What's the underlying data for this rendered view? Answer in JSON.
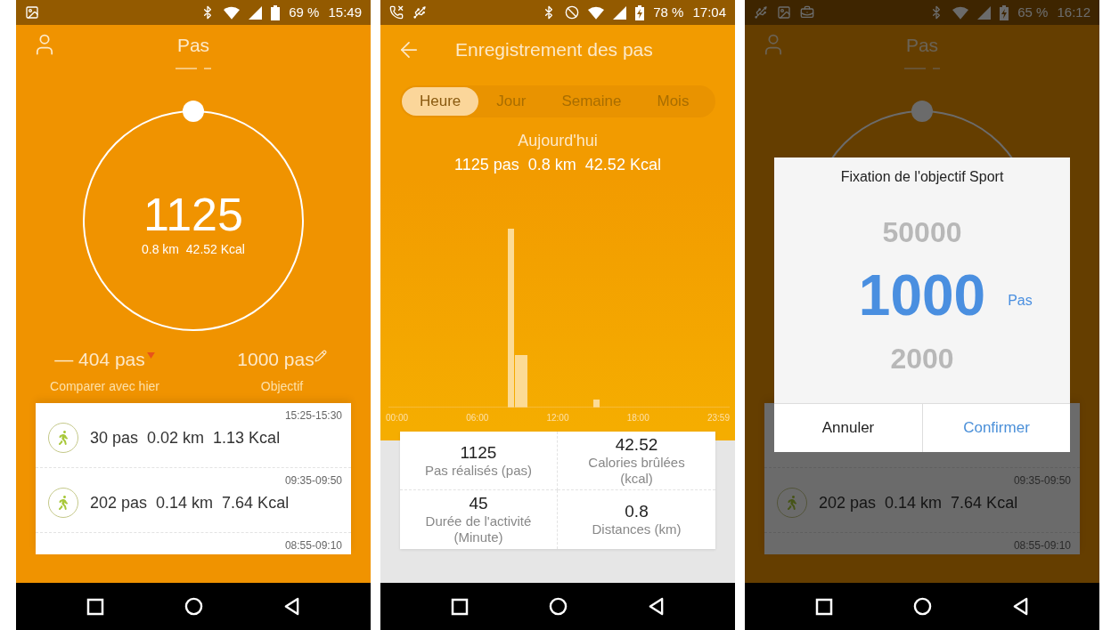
{
  "screens": [
    {
      "kind": "home",
      "status_bar": {
        "left_icons": [
          {
            "kind": "image"
          }
        ],
        "right_icons": [
          {
            "kind": "bluetooth"
          },
          {
            "kind": "wifi"
          },
          {
            "kind": "signal"
          },
          {
            "kind": "battery"
          }
        ],
        "charging": false,
        "battery": "69 %",
        "time": "15:49"
      },
      "title": "Pas",
      "ring": {
        "steps": "1125",
        "summary": "0.8 km  42.52 Kcal"
      },
      "compare": {
        "value": "— 404 pas",
        "label": "Comparer avec hier"
      },
      "goal": {
        "value": "1000 pas",
        "label": "Objectif"
      },
      "records": [
        {
          "kind": "entry",
          "time": "15:25-15:30",
          "summary": "30 pas  0.02 km  1.13 Kcal"
        },
        {
          "kind": "entry",
          "time": "09:35-09:50",
          "summary": "202 pas  0.14 km  7.64 Kcal"
        },
        {
          "kind": "cut",
          "time": "08:55-09:10"
        }
      ]
    },
    {
      "kind": "record",
      "status_bar": {
        "left_icons": [
          {
            "kind": "call-missed"
          },
          {
            "kind": "usb"
          }
        ],
        "right_icons": [
          {
            "kind": "bluetooth"
          },
          {
            "kind": "dnd"
          },
          {
            "kind": "wifi"
          },
          {
            "kind": "signal"
          },
          {
            "kind": "battery"
          }
        ],
        "charging": true,
        "battery": "78 %",
        "time": "17:04"
      },
      "title": "Enregistrement des pas",
      "tabs": [
        {
          "label": "Heure",
          "selected": true
        },
        {
          "label": "Jour",
          "selected": false
        },
        {
          "label": "Semaine",
          "selected": false
        },
        {
          "label": "Mois",
          "selected": false
        }
      ],
      "period": "Aujourd'hui",
      "summary": "1125 pas  0.8 km  42.52 Kcal",
      "x_labels": [
        "00:00",
        "06:00",
        "12:00",
        "18:00",
        "23:59"
      ],
      "stats": [
        {
          "value": "1125",
          "label": "Pas réalisés (pas)"
        },
        {
          "value": "42.52",
          "label": "Calories brûlées (kcal)"
        },
        {
          "value": "45",
          "label": "Durée de l'activité (Minute)"
        },
        {
          "value": "0.8",
          "label": "Distances (km)"
        }
      ]
    },
    {
      "kind": "home",
      "status_bar": {
        "left_icons": [
          {
            "kind": "usb"
          },
          {
            "kind": "image"
          },
          {
            "kind": "briefcase"
          }
        ],
        "right_icons": [
          {
            "kind": "bluetooth"
          },
          {
            "kind": "wifi"
          },
          {
            "kind": "signal"
          },
          {
            "kind": "battery"
          }
        ],
        "charging": true,
        "battery": "65 %",
        "time": "16:12"
      },
      "title": "Pas",
      "records": [
        {
          "kind": "covered"
        },
        {
          "kind": "entry",
          "time": "09:35-09:50",
          "summary": "202 pas  0.14 km  7.64 Kcal"
        },
        {
          "kind": "cut",
          "time": "08:55-09:10"
        }
      ],
      "dialog": {
        "title": "Fixation de l'objectif Sport",
        "unit": "Pas",
        "options": [
          {
            "value": "50000",
            "selected": false
          },
          {
            "value": "1000",
            "selected": true
          },
          {
            "value": "2000",
            "selected": false
          }
        ],
        "buttons": [
          {
            "label": "Annuler",
            "kind": "cancel"
          },
          {
            "label": "Confirmer",
            "kind": "confirm"
          }
        ]
      }
    }
  ]
}
